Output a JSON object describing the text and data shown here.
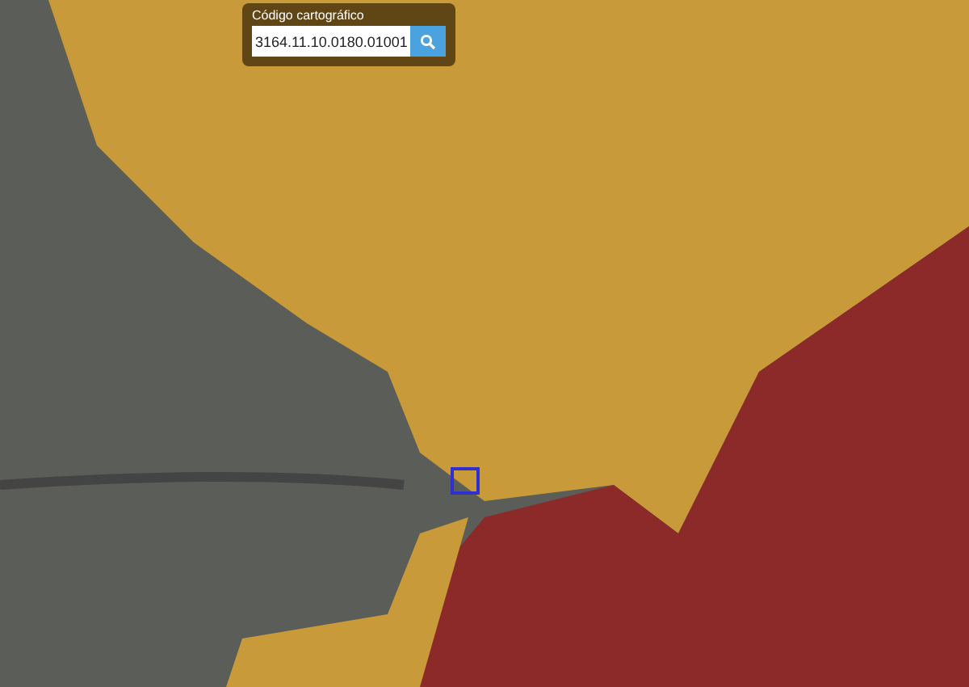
{
  "search_panel": {
    "label": "Código cartográfico",
    "value": "3164.11.10.0180.01001"
  }
}
